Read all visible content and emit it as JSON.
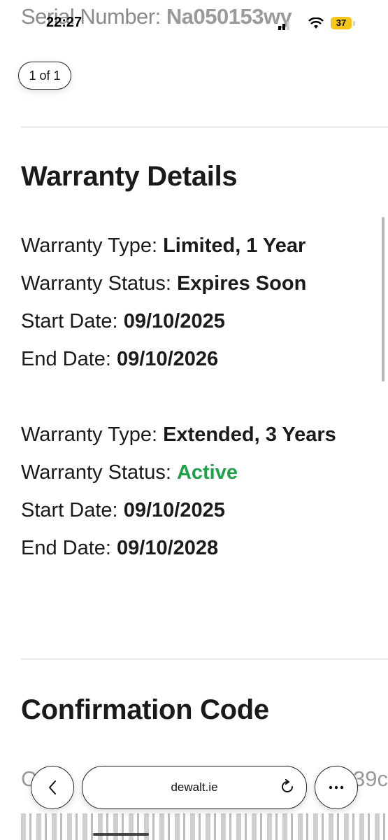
{
  "serial": {
    "label": "Serial Number:",
    "value": "Na050153wy"
  },
  "status_bar": {
    "time": "22:27",
    "battery": "37"
  },
  "pager": {
    "label": "1 of 1"
  },
  "warranty": {
    "title": "Warranty Details",
    "items": [
      {
        "type_label": "Warranty Type:",
        "type_value": "Limited, 1 Year",
        "status_label": "Warranty Status:",
        "status_value": "Expires Soon",
        "start_label": "Start Date:",
        "start_value": "09/10/2025",
        "end_label": "End Date:",
        "end_value": "09/10/2026"
      },
      {
        "type_label": "Warranty Type:",
        "type_value": "Extended, 3 Years",
        "status_label": "Warranty Status:",
        "status_value": "Active",
        "start_label": "Start Date:",
        "start_value": "09/10/2025",
        "end_label": "End Date:",
        "end_value": "09/10/2028"
      }
    ]
  },
  "confirmation": {
    "title": "Confirmation Code",
    "obscured_start": "C",
    "obscured_end": "39c"
  },
  "browser": {
    "url": "dewalt.ie",
    "back_icon": "back-chevron-icon",
    "reload_icon": "reload-icon",
    "more_icon": "more-icon"
  },
  "colors": {
    "active": "#1fa14a",
    "battery": "#f5c518"
  }
}
